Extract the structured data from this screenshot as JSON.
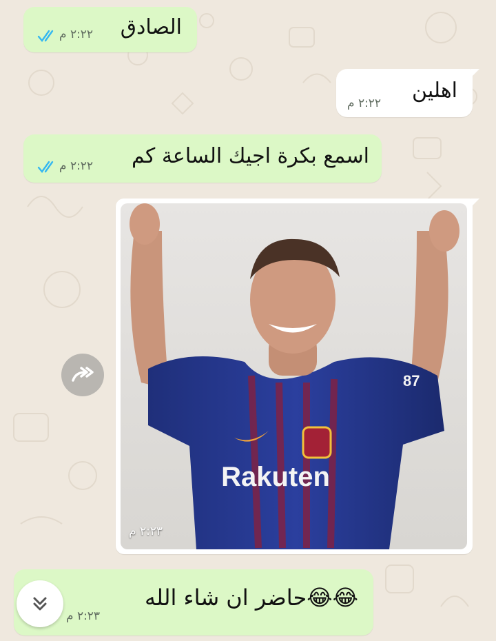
{
  "chat": {
    "messages": [
      {
        "direction": "outgoing",
        "text": "الصادق",
        "time": "٢:٢٢ م",
        "status": "read"
      },
      {
        "direction": "incoming",
        "text": "اهلين",
        "time": "٢:٢٢ م"
      },
      {
        "direction": "outgoing",
        "text": "اسمع بكرة اجيك الساعة كم",
        "time": "٢:٢٢ م",
        "status": "read"
      },
      {
        "direction": "incoming",
        "type": "image",
        "time": "٢:٢٣ م",
        "image": {
          "jersey_sponsor": "Rakuten",
          "jersey_number": "87"
        }
      },
      {
        "direction": "outgoing",
        "text": "حاضر ان شاء الله",
        "emoji": "😂😂",
        "time": "٢:٢٣ م",
        "status": "read"
      }
    ]
  },
  "colors": {
    "wallpaper": "#efe8de",
    "outgoing_bubble": "#dcf8c6",
    "incoming_bubble": "#ffffff",
    "read_ticks": "#34b7f1"
  },
  "icons": {
    "forward": "forward-icon",
    "scroll_down": "double-chevron-down-icon",
    "read_receipt": "double-check-icon"
  }
}
